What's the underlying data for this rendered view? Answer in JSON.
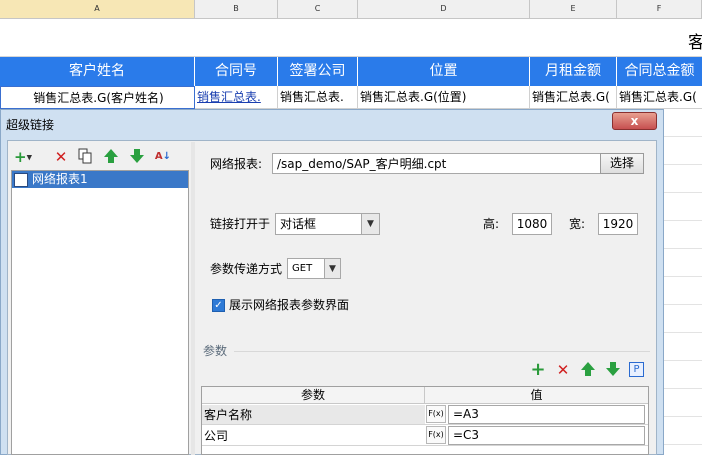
{
  "sheet": {
    "columns": [
      "A",
      "B",
      "C",
      "D",
      "E",
      "F"
    ],
    "title_fragment": "客",
    "headers": [
      "客户姓名",
      "合同号",
      "签署公司",
      "位置",
      "月租金额",
      "合同总金额"
    ],
    "row": [
      "销售汇总表.G(客户姓名)",
      "销售汇总表.",
      "销售汇总表.",
      "销售汇总表.G(位置)",
      "销售汇总表.G(",
      "销售汇总表.G("
    ]
  },
  "dialog": {
    "title": "超级链接",
    "close_label": "x",
    "toolbar_icons": [
      "add-icon",
      "delete-icon",
      "copy-icon",
      "move-up-icon",
      "move-down-icon",
      "sort-icon"
    ],
    "tree": {
      "items": [
        {
          "label": "网络报表1",
          "selected": true
        }
      ]
    },
    "form": {
      "report_label": "网络报表:",
      "report_value": "/sap_demo/SAP_客户明细.cpt",
      "choose_button": "选择",
      "open_in_label": "链接打开于",
      "open_in_value": "对话框",
      "height_label": "高:",
      "height_value": "1080",
      "width_label": "宽:",
      "width_value": "1920",
      "method_label": "参数传递方式",
      "method_value": "GET",
      "show_params_label": "展示网络报表参数界面",
      "show_params_checked": true
    },
    "params": {
      "group_label": "参数",
      "toolbar_icons": [
        "add-icon",
        "delete-icon",
        "move-up-icon",
        "move-down-icon",
        "param-icon"
      ],
      "param_icon_glyph": "P",
      "columns": [
        "参数",
        "值"
      ],
      "rows": [
        {
          "name": "客户名称",
          "fx": "F(x)",
          "value": "=A3"
        },
        {
          "name": "公司",
          "fx": "F(x)",
          "value": "=C3"
        }
      ]
    }
  }
}
